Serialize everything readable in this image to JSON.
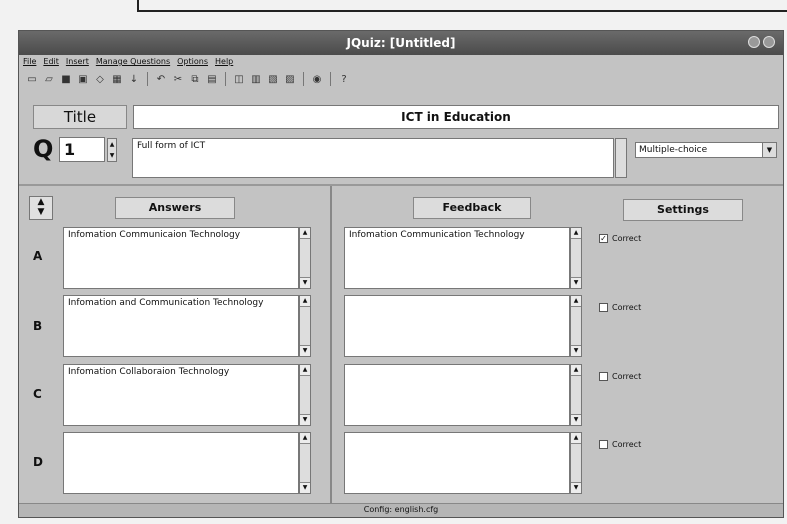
{
  "window": {
    "title": "JQuiz: [Untitled]"
  },
  "menu": [
    "File",
    "Edit",
    "Insert",
    "Manage Questions",
    "Options",
    "Help"
  ],
  "toolbar_icons": [
    "new-icon",
    "open-icon",
    "save-icon",
    "save-as-icon",
    "load-icon",
    "export-icon",
    "arrow-down-icon",
    "undo-icon",
    "cut-icon",
    "copy-icon",
    "paste-icon",
    "web-page-icon",
    "print-icon",
    "zip-icon",
    "config-icon",
    "help-icon"
  ],
  "quiz_title": {
    "label": "Title",
    "value": "ICT in Education"
  },
  "question": {
    "prefix": "Q",
    "number": "1",
    "text": "Full form of ICT",
    "type": "Multiple-choice"
  },
  "headers": {
    "answers": "Answers",
    "feedback": "Feedback",
    "settings": "Settings"
  },
  "answers": [
    {
      "letter": "A",
      "answer": "Infomation Communicaion Technology",
      "feedback": "Infomation Communication Technology",
      "correct_label": "Correct",
      "checked": true
    },
    {
      "letter": "B",
      "answer": "Infomation and Communication Technology",
      "feedback": "",
      "correct_label": "Correct",
      "checked": false
    },
    {
      "letter": "C",
      "answer": "Infomation Collaboraion Technology",
      "feedback": "",
      "correct_label": "Correct",
      "checked": false
    },
    {
      "letter": "D",
      "answer": "",
      "feedback": "",
      "correct_label": "Correct",
      "checked": false
    }
  ],
  "status": "Config: english.cfg"
}
